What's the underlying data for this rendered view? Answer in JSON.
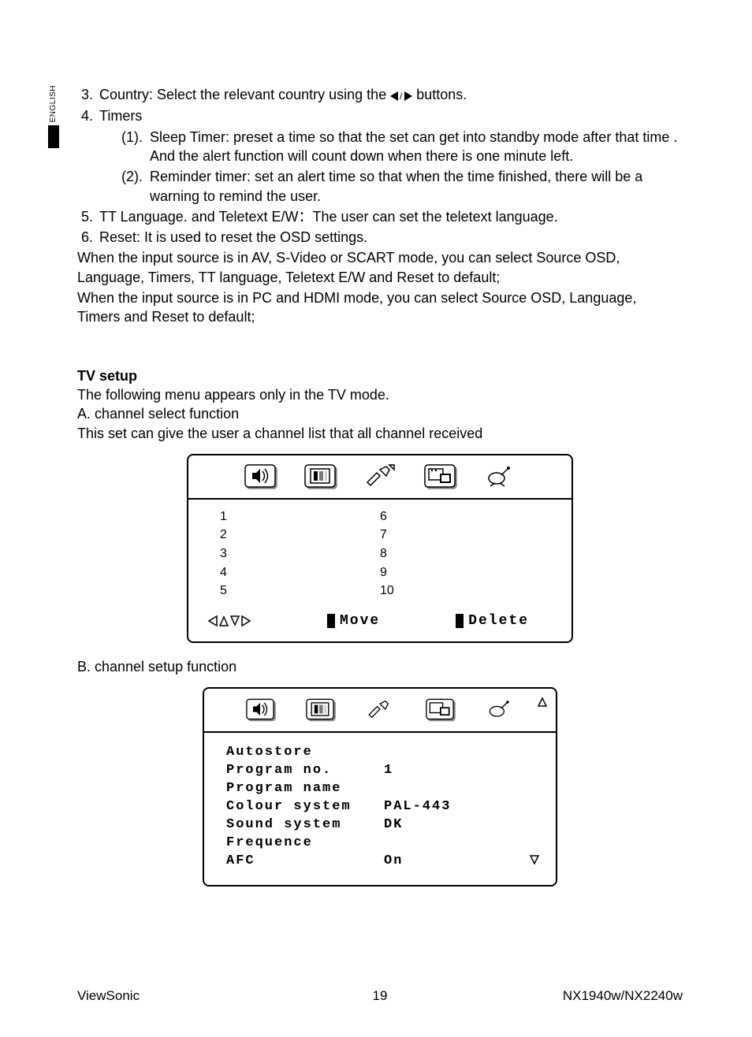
{
  "sideTab": {
    "lang": "ENGLISH"
  },
  "list": {
    "item3": {
      "num": "3.",
      "text_a": "Country: Select the relevant country using the",
      "text_b": "buttons."
    },
    "item4": {
      "num": "4.",
      "label": "Timers",
      "sub1": {
        "num": "(1).",
        "text": "Sleep Timer: preset a time so that the set can get into standby mode after that time . And the alert function will count down when there is one minute left."
      },
      "sub2": {
        "num": "(2).",
        "text": "Reminder timer: set an alert time so that when the time finished, there will be a warning to remind the user."
      }
    },
    "item5": {
      "num": "5.",
      "text": "TT Language. and Teletext E/W：The user can set the teletext language."
    },
    "item6": {
      "num": "6.",
      "text": "Reset: It is used to reset the OSD settings."
    }
  },
  "notes": {
    "p1": "When the input source is in AV, S-Video or SCART mode, you can select Source OSD, Language, Timers, TT language, Teletext E/W and Reset to default;",
    "p2": "When the input source is in PC and HDMI mode, you can select Source OSD, Language, Timers and Reset to default;"
  },
  "tvsetup": {
    "heading": "TV setup",
    "line1": "The following menu appears only in the TV mode.",
    "line2": "A. channel select function",
    "line3": "This set can give the user a channel list that all channel received"
  },
  "chList": {
    "left": [
      "1",
      "2",
      "3",
      "4",
      "5"
    ],
    "right": [
      "6",
      "7",
      "8",
      "9",
      "10"
    ],
    "moveLabel": "Move",
    "deleteLabel": "Delete"
  },
  "sectionB": "B. channel setup function",
  "chSetup": {
    "rows": [
      {
        "k": "Autostore",
        "v": ""
      },
      {
        "k": "Program no.",
        "v": "1"
      },
      {
        "k": "Program name",
        "v": ""
      },
      {
        "k": "Colour system",
        "v": "PAL-443"
      },
      {
        "k": "Sound system",
        "v": "DK"
      },
      {
        "k": "Frequence",
        "v": ""
      },
      {
        "k": "AFC",
        "v": "On"
      }
    ]
  },
  "footer": {
    "left": "ViewSonic",
    "center": "19",
    "right": "NX1940w/NX2240w"
  }
}
